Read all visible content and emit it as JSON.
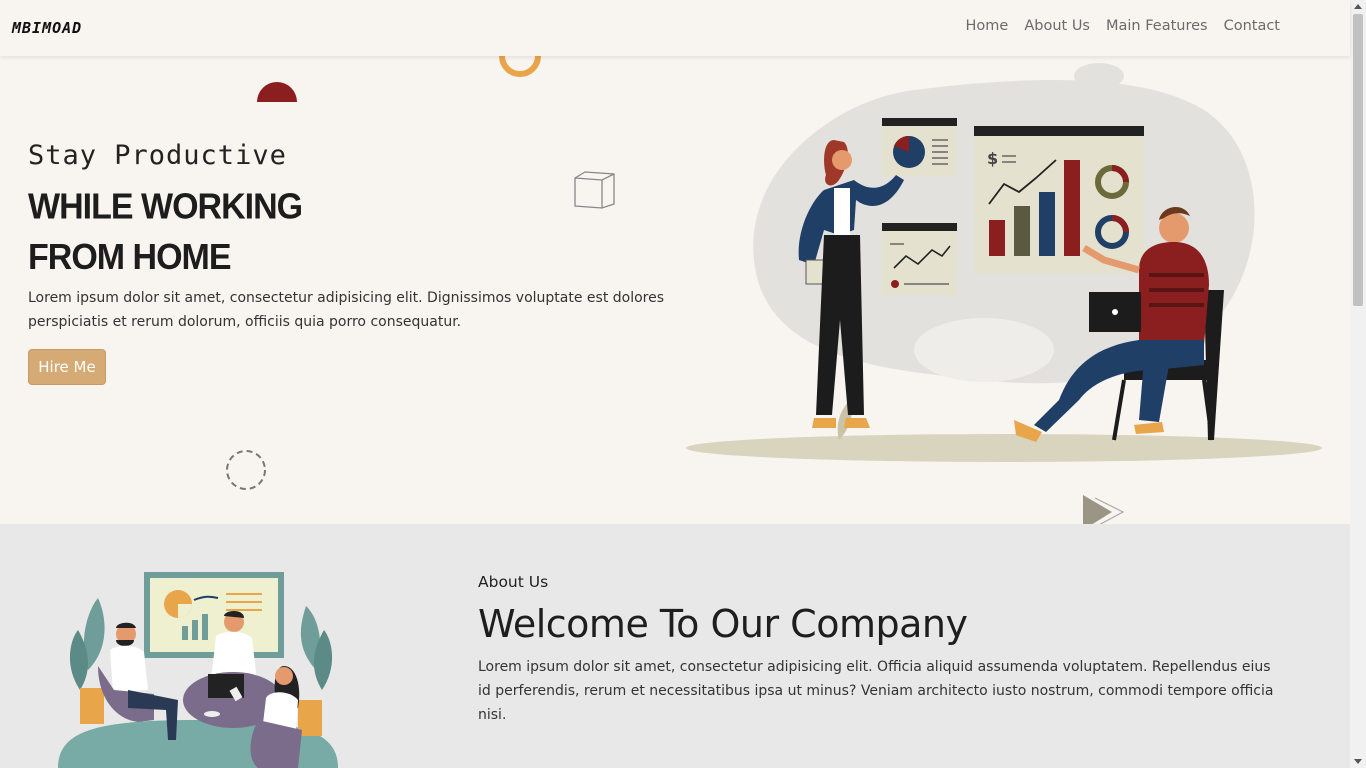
{
  "brand": "MBIMOAD",
  "nav": {
    "items": [
      "Home",
      "About Us",
      "Main Features",
      "Contact"
    ]
  },
  "hero": {
    "subtitle": "Stay Productive",
    "title_line1": "WHILE WORKING",
    "title_line2": "FROM HOME",
    "text": "Lorem ipsum dolor sit amet, consectetur adipisicing elit. Dignissimos voluptate est dolores perspiciatis et rerum dolorum, officiis quia porro consequatur.",
    "button": "Hire Me"
  },
  "about": {
    "kicker": "About Us",
    "title": "Welcome To Our Company",
    "text": "Lorem ipsum dolor sit amet, consectetur adipisicing elit. Officia aliquid assumenda voluptatem. Repellendus eius id perferendis, rerum et necessitatibus ipsa ut minus? Veniam architecto iusto nostrum, commodi tempore officia nisi."
  },
  "colors": {
    "background": "#f8f4f0",
    "accent": "#d5aa74",
    "dark_red": "#8b1e1e",
    "section_gray": "#e8e8e8",
    "navy": "#1f3f66"
  },
  "icons": [
    "semicircle-icon",
    "ring-icon",
    "cube-icon",
    "dashed-circle-icon",
    "play-arrows-icon"
  ]
}
